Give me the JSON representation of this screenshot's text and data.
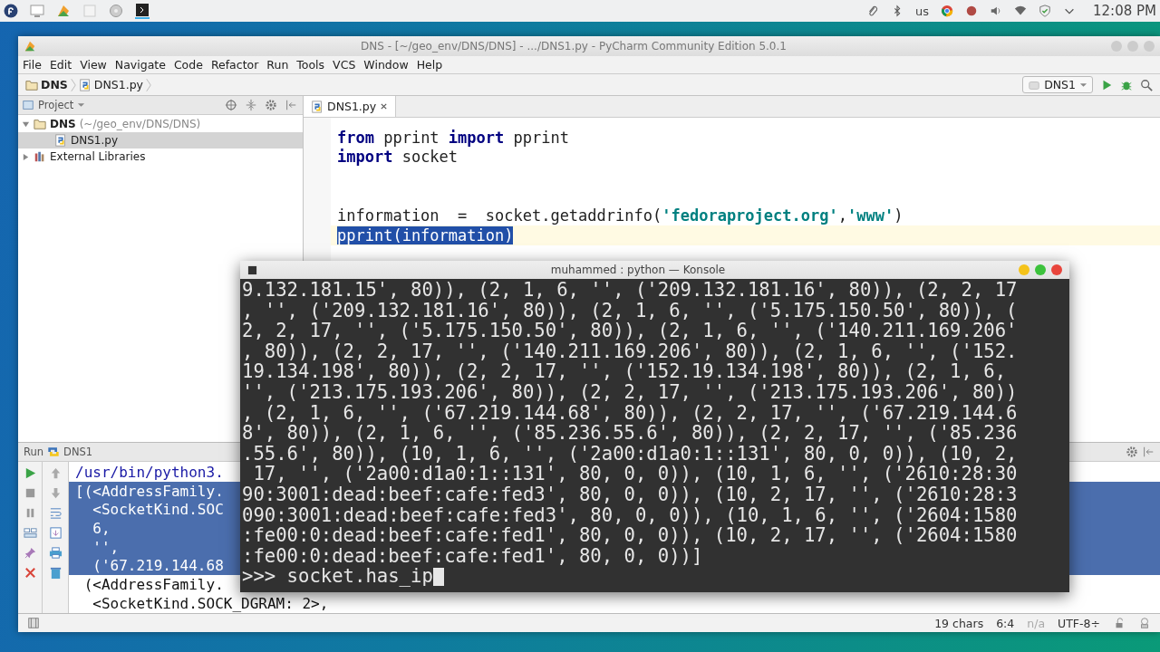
{
  "top_panel": {
    "keyboard_layout": "us",
    "clock": "12:08 PM"
  },
  "ide": {
    "title": "DNS - [~/geo_env/DNS/DNS] - .../DNS1.py - PyCharm Community Edition 5.0.1",
    "menu": [
      "File",
      "Edit",
      "View",
      "Navigate",
      "Code",
      "Refactor",
      "Run",
      "Tools",
      "VCS",
      "Window",
      "Help"
    ],
    "breadcrumb": [
      {
        "label": "DNS",
        "kind": "folder"
      },
      {
        "label": "DNS1.py",
        "kind": "python"
      }
    ],
    "run_config": "DNS1",
    "project_panel": {
      "label": "Project",
      "tree": [
        {
          "label": "DNS",
          "hint": "(~/geo_env/DNS/DNS)",
          "kind": "folder",
          "expanded": true,
          "selected": false,
          "children": [
            {
              "label": "DNS1.py",
              "kind": "python",
              "selected": true
            }
          ]
        },
        {
          "label": "External Libraries",
          "kind": "library",
          "expanded": false,
          "selected": false
        }
      ]
    },
    "editor_tabs": [
      {
        "label": "DNS1.py",
        "selected": true
      }
    ],
    "code_lines": [
      {
        "kind": "code",
        "selected": false,
        "current": false,
        "tokens": [
          {
            "kind": "keyword",
            "text": "from"
          },
          {
            "kind": "plain",
            "text": " pprint "
          },
          {
            "kind": "keyword",
            "text": "import"
          },
          {
            "kind": "plain",
            "text": " pprint"
          }
        ]
      },
      {
        "kind": "code",
        "selected": false,
        "current": false,
        "tokens": [
          {
            "kind": "keyword",
            "text": "import"
          },
          {
            "kind": "plain",
            "text": " socket"
          }
        ]
      },
      {
        "kind": "blank"
      },
      {
        "kind": "blank"
      },
      {
        "kind": "code",
        "selected": false,
        "current": false,
        "tokens": [
          {
            "kind": "plain",
            "text": "information  =  socket.getaddrinfo("
          },
          {
            "kind": "string",
            "text": "'fedoraproject.org'"
          },
          {
            "kind": "plain",
            "text": ","
          },
          {
            "kind": "string",
            "text": "'www'"
          },
          {
            "kind": "plain",
            "text": ")"
          }
        ]
      },
      {
        "kind": "code",
        "selected": true,
        "current": true,
        "tokens": [
          {
            "kind": "plain",
            "text": "pprint(information)"
          }
        ]
      }
    ],
    "run_panel": {
      "title": "Run",
      "config": "DNS1",
      "output": [
        {
          "kind": "command",
          "text": "/usr/bin/python3.",
          "selected": false
        },
        {
          "kind": "output",
          "text": "[(<AddressFamily.",
          "selected": true
        },
        {
          "kind": "output",
          "text": "  <SocketKind.SOC",
          "selected": true
        },
        {
          "kind": "output",
          "text": "  6,",
          "selected": true
        },
        {
          "kind": "output",
          "text": "  '',",
          "selected": true
        },
        {
          "kind": "output",
          "text": "  ('67.219.144.68",
          "selected": true
        },
        {
          "kind": "output",
          "text": " (<AddressFamily.",
          "selected": false
        },
        {
          "kind": "output",
          "text": "  <SocketKind.SOCK_DGRAM: 2>,",
          "selected": false
        }
      ]
    },
    "status_bar": {
      "chars": "19 chars",
      "position": "6:4",
      "insert_mode": "n/a",
      "encoding": "UTF-8÷"
    }
  },
  "konsole": {
    "title": "muhammed : python — Konsole",
    "lines": [
      "9.132.181.15', 80)), (2, 1, 6, '', ('209.132.181.16', 80)), (2, 2, 17",
      ", '', ('209.132.181.16', 80)), (2, 1, 6, '', ('5.175.150.50', 80)), (",
      "2, 2, 17, '', ('5.175.150.50', 80)), (2, 1, 6, '', ('140.211.169.206'",
      ", 80)), (2, 2, 17, '', ('140.211.169.206', 80)), (2, 1, 6, '', ('152.",
      "19.134.198', 80)), (2, 2, 17, '', ('152.19.134.198', 80)), (2, 1, 6,",
      "'', ('213.175.193.206', 80)), (2, 2, 17, '', ('213.175.193.206', 80))",
      ", (2, 1, 6, '', ('67.219.144.68', 80)), (2, 2, 17, '', ('67.219.144.6",
      "8', 80)), (2, 1, 6, '', ('85.236.55.6', 80)), (2, 2, 17, '', ('85.236",
      ".55.6', 80)), (10, 1, 6, '', ('2a00:d1a0:1::131', 80, 0, 0)), (10, 2,",
      " 17, '', ('2a00:d1a0:1::131', 80, 0, 0)), (10, 1, 6, '', ('2610:28:30",
      "90:3001:dead:beef:cafe:fed3', 80, 0, 0)), (10, 2, 17, '', ('2610:28:3",
      "090:3001:dead:beef:cafe:fed3', 80, 0, 0)), (10, 1, 6, '', ('2604:1580",
      ":fe00:0:dead:beef:cafe:fed1', 80, 0, 0)), (10, 2, 17, '', ('2604:1580",
      ":fe00:0:dead:beef:cafe:fed1', 80, 0, 0))]"
    ],
    "prompt": ">>> socket.has_ip"
  }
}
